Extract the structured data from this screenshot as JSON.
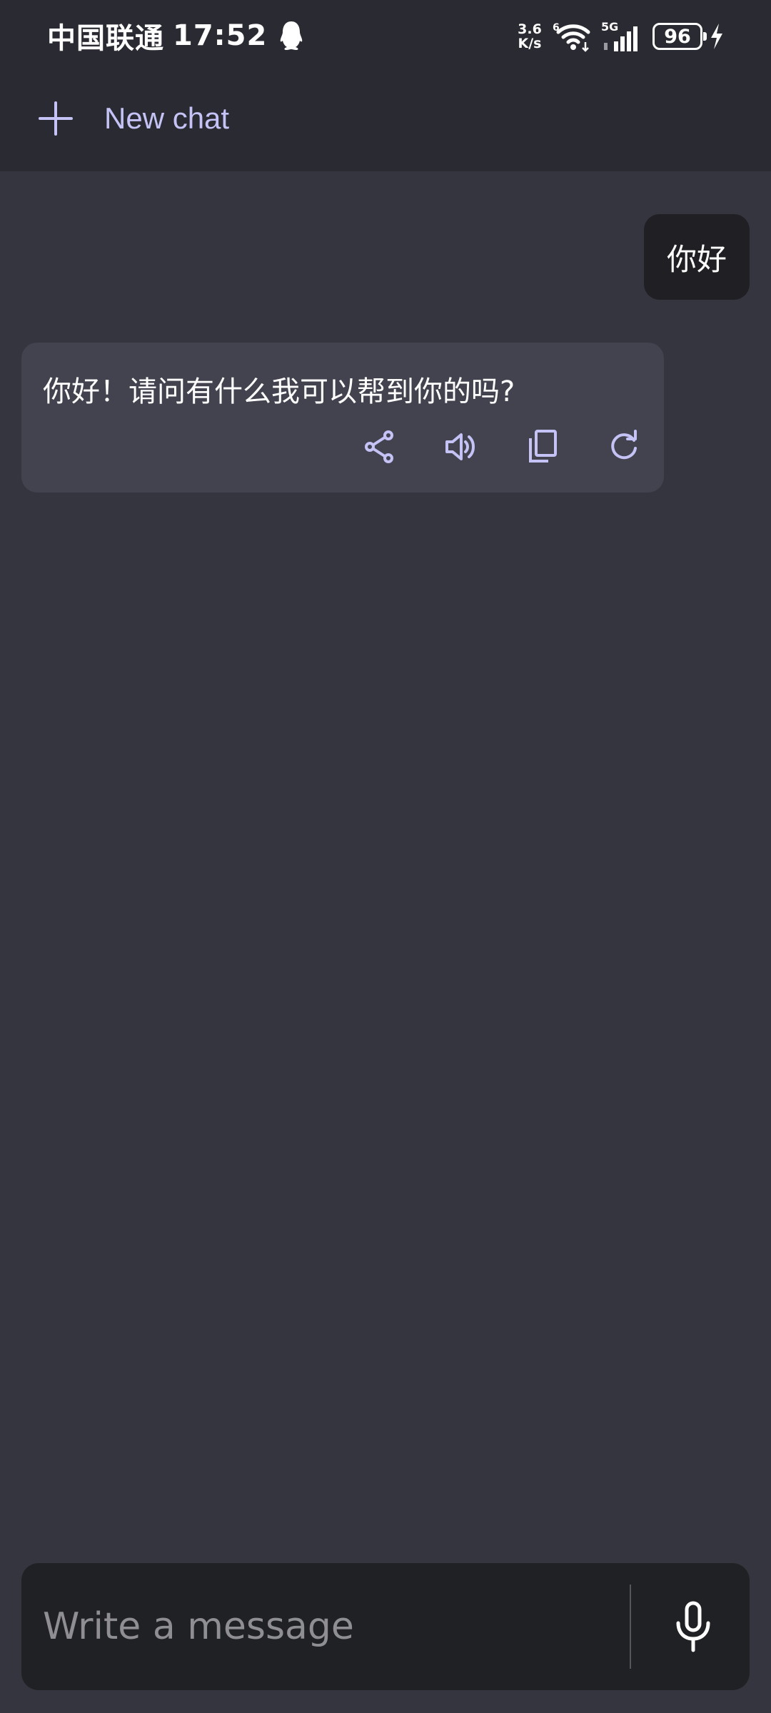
{
  "status_bar": {
    "carrier": "中国联通",
    "time": "17:52",
    "net_speed_value": "3.6",
    "net_speed_unit": "K/s",
    "wifi_badge": "6",
    "cell_label": "5G",
    "battery_level": "96",
    "charging": true
  },
  "header": {
    "new_chat_label": "New chat"
  },
  "messages": {
    "user_text": "你好",
    "assistant_text": "你好！请问有什么我可以帮到你的吗?"
  },
  "composer": {
    "placeholder": "Write a message",
    "value": ""
  },
  "colors": {
    "accent": "#C5C3F6",
    "background": "#35353F",
    "header": "#2A2A32",
    "assistant_bubble": "#43434F",
    "user_bubble": "#202024"
  }
}
